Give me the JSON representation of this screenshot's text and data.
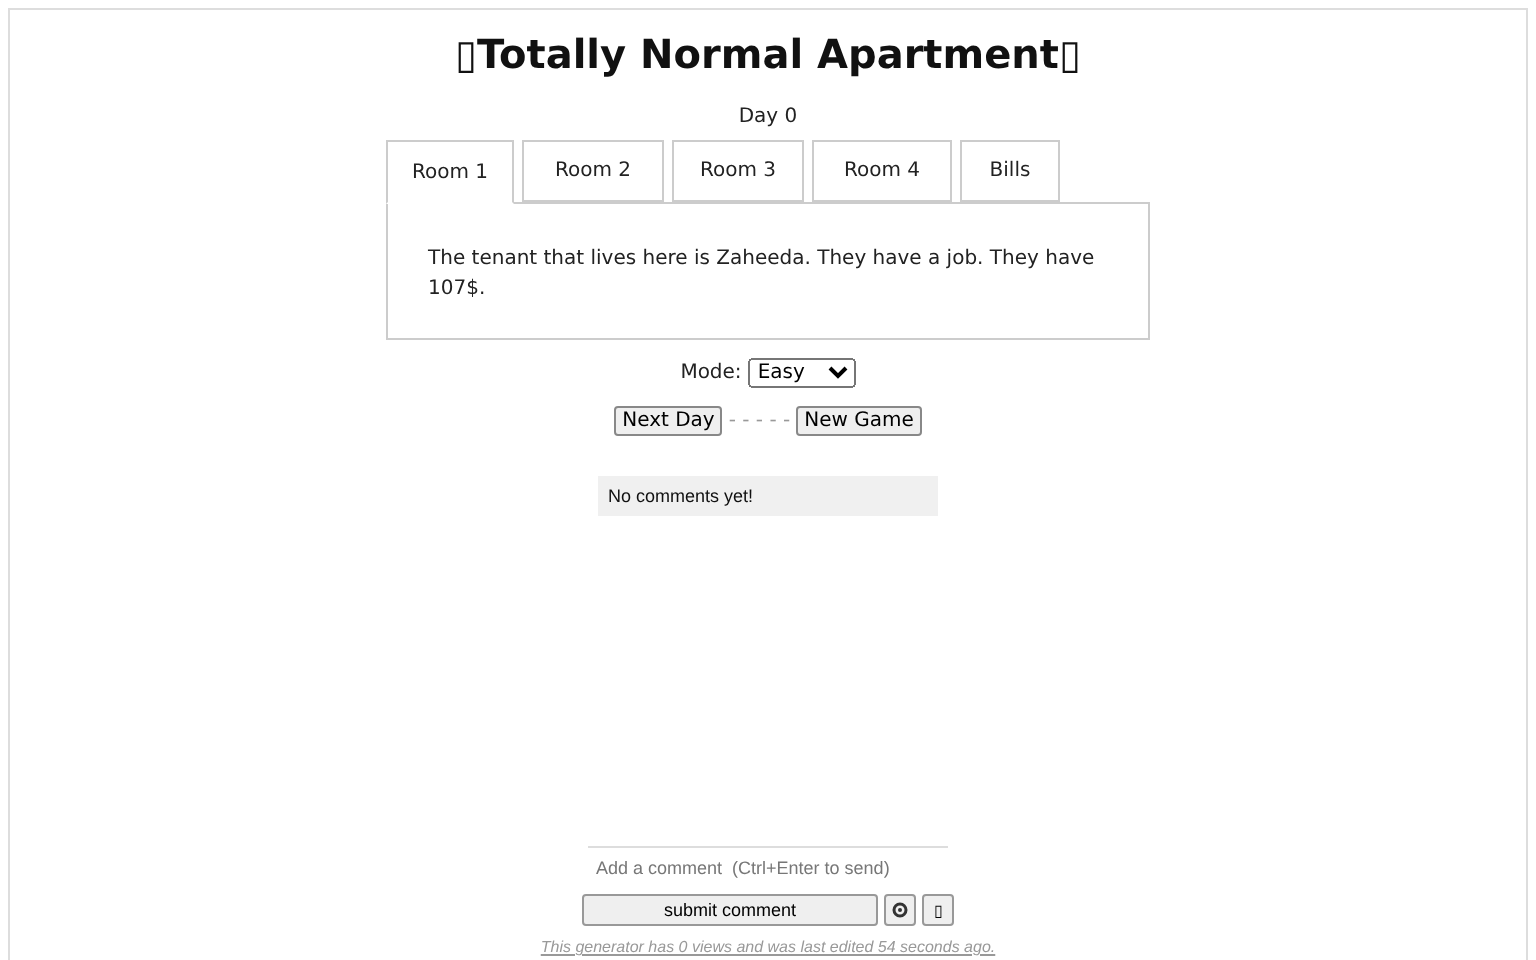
{
  "title": "▯Totally Normal Apartment▯",
  "day": "Day 0",
  "tabs": [
    {
      "label": "Room 1",
      "selected": true
    },
    {
      "label": "Room 2",
      "selected": false
    },
    {
      "label": "Room 3",
      "selected": false
    },
    {
      "label": "Room 4",
      "selected": false
    },
    {
      "label": "Bills",
      "selected": false
    }
  ],
  "panel_text": "The tenant that lives here is Zaheeda. They have a job. They have 107$.",
  "mode": {
    "label": "Mode:",
    "value": "Easy"
  },
  "buttons": {
    "next": "Next Day",
    "separator": "- - - - -",
    "new": "New Game"
  },
  "comments": {
    "empty": "No comments yet!",
    "placeholder": "Add a comment  (Ctrl+Enter to send)",
    "submit": "submit comment",
    "extra": "▯"
  },
  "footer": "This generator has 0 views and was last edited 54 seconds ago."
}
